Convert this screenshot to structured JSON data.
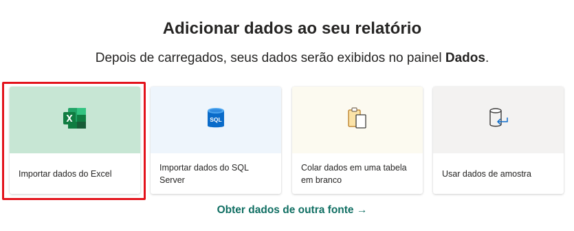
{
  "header": {
    "title": "Adicionar dados ao seu relatório",
    "subtitle_prefix": "Depois de carregados, seus dados serão exibidos no painel",
    "subtitle_bold": "Dados",
    "subtitle_suffix": "."
  },
  "cards": [
    {
      "label": "Importar dados do Excel",
      "icon": "excel-icon",
      "accent": "#c7e6d4",
      "highlighted": true
    },
    {
      "label": "Importar dados do SQL Server",
      "icon": "sql-database-icon",
      "accent": "#eef5fc",
      "icon_text": "SQL"
    },
    {
      "label": "Colar dados em uma tabela em branco",
      "icon": "clipboard-paste-icon",
      "accent": "#fcfaf0"
    },
    {
      "label": "Usar dados de amostra",
      "icon": "sample-data-icon",
      "accent": "#f3f2f1"
    }
  ],
  "footer": {
    "more_sources_link": "Obter dados de outra fonte →"
  },
  "colors": {
    "highlight_border": "#e3121b",
    "link": "#0f6e62",
    "excel_green": "#107c41"
  }
}
